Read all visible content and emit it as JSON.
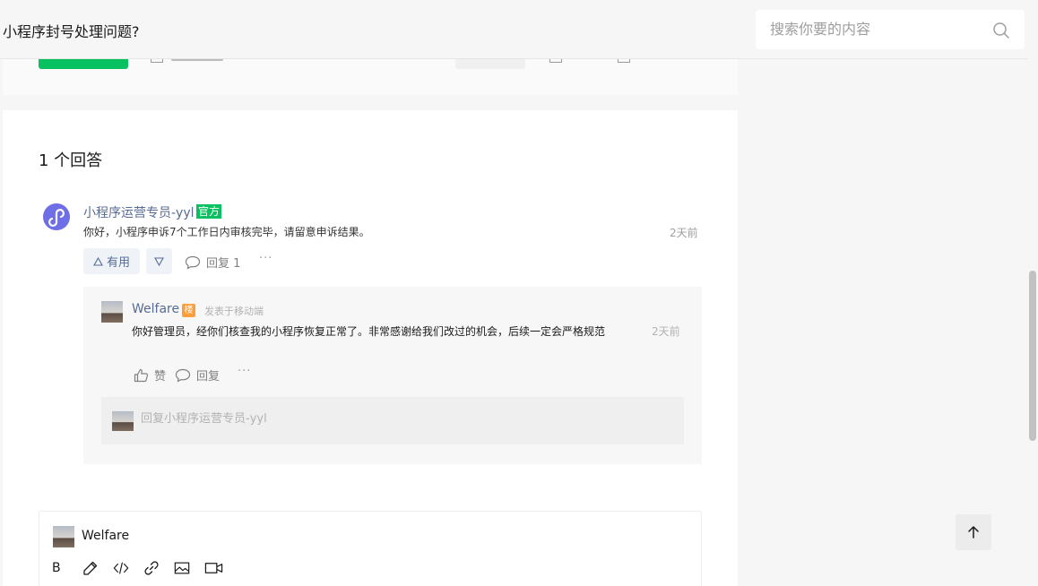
{
  "header": {
    "title": "小程序封号处理问题?",
    "search_placeholder": "搜索你要的内容"
  },
  "answers": {
    "count_label": "1 个回答",
    "items": [
      {
        "author": "小程序运营专员-yyl",
        "badge": "官方",
        "text": "你好，小程序申诉7个工作日内审核完毕，请留意申诉结果。",
        "time": "2天前",
        "useful_label": "有用",
        "reply_label": "回复 1",
        "more": "···"
      }
    ]
  },
  "nested_reply": {
    "author": "Welfare",
    "owner_badge": "楼",
    "source": "发表于移动端",
    "text": "你好管理员，经你们核查我的小程序恢复正常了。非常感谢给我们改过的机会，后续一定会严格规范",
    "time": "2天前",
    "like_label": "赞",
    "reply_label": "回复",
    "more": "···",
    "input_placeholder": "回复小程序运营专员-yyl"
  },
  "editor": {
    "username": "Welfare",
    "bold_label": "B"
  },
  "colors": {
    "brand_green": "#07c160",
    "link_blue": "#576b95",
    "owner_orange": "#fa9d3b"
  }
}
